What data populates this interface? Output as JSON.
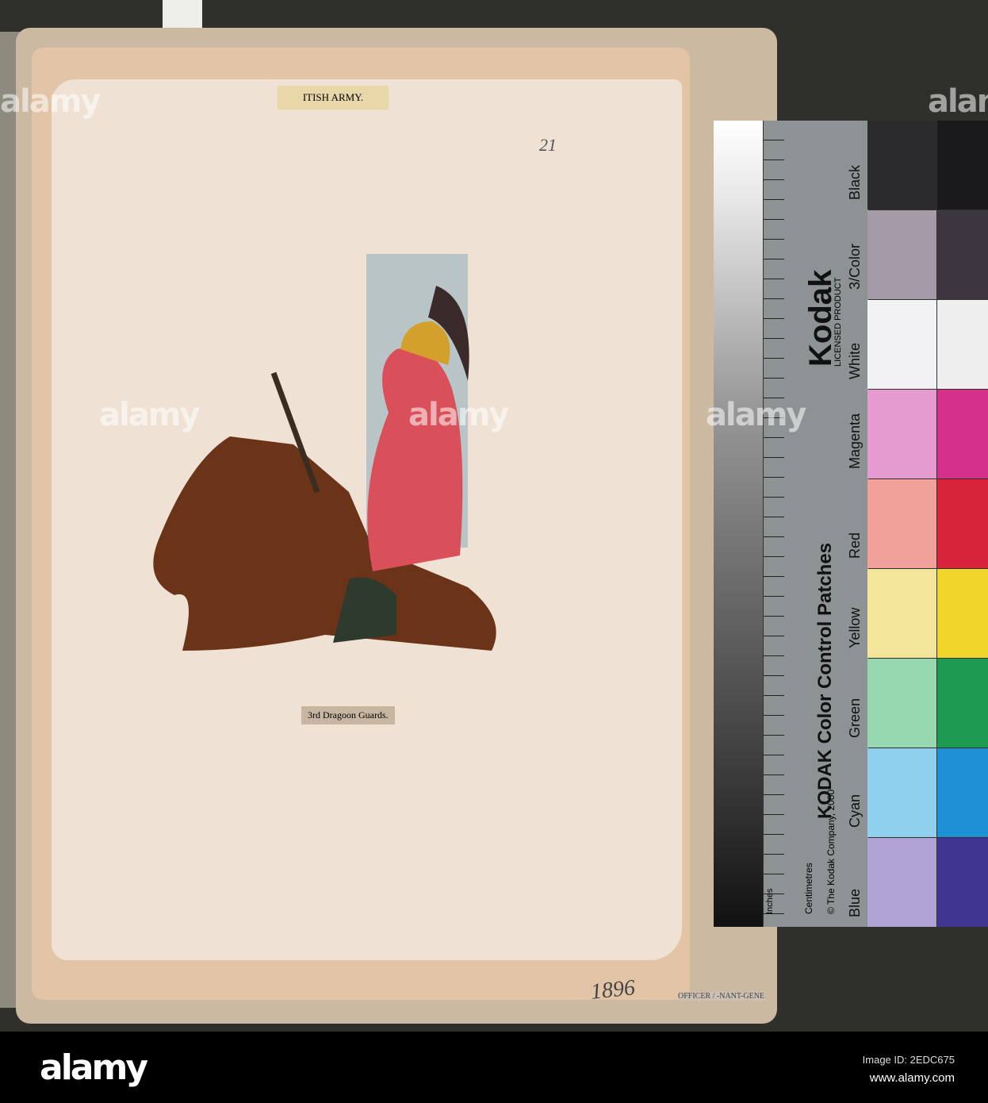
{
  "scrapbook": {
    "header_label": "ITISH ARMY.",
    "page_number": "21",
    "caption": "3rd Dragoon Guards.",
    "year": "1896",
    "bottom_text": "OFFICER / -NANT-GENE"
  },
  "target": {
    "brand": "Kodak",
    "licensed": "LICENSED PRODUCT",
    "title": "KODAK Color Control Patches",
    "copyright": "© The Kodak Company, 2000",
    "inches": "Inches",
    "centimetres": "Centimetres",
    "patches": [
      {
        "label": "Black",
        "c1": "#2b2b2e",
        "c2": "#1a1a1c"
      },
      {
        "label": "3/Color",
        "c1": "#a49aa8",
        "c2": "#3b3640"
      },
      {
        "label": "White",
        "c1": "#f2f1f3",
        "c2": "#eeeeee"
      },
      {
        "label": "Magenta",
        "c1": "#e59ad0",
        "c2": "#d6318a"
      },
      {
        "label": "Red",
        "c1": "#f1a09a",
        "c2": "#d8243a"
      },
      {
        "label": "Yellow",
        "c1": "#f3e69a",
        "c2": "#f0d52b"
      },
      {
        "label": "Green",
        "c1": "#97d8b0",
        "c2": "#1f9a52"
      },
      {
        "label": "Cyan",
        "c1": "#8fd0ee",
        "c2": "#1f8fd6"
      },
      {
        "label": "Blue",
        "c1": "#b0a3d6",
        "c2": "#3e3690"
      }
    ]
  },
  "watermark": {
    "logo": "alamy",
    "image_id": "Image ID: 2EDC675",
    "url": "www.alamy.com"
  }
}
